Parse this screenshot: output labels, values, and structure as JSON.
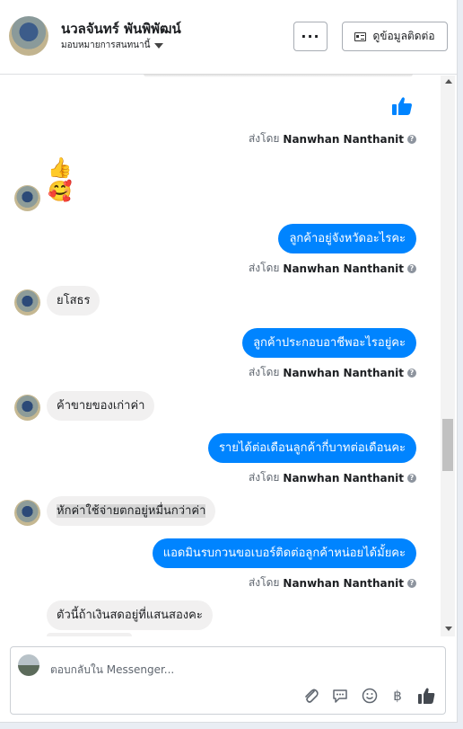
{
  "header": {
    "name": "นวลจันทร์ พันพิพัฒน์",
    "subtitle": "มอบหมายการสนทนานี้",
    "more_label": "···",
    "contact_label": "ดูข้อมูลติดต่อ"
  },
  "sent_prefix": "ส่งโดย",
  "sender": "Nanwhan Nanthanit",
  "info_glyph": "?",
  "messages": [
    {
      "type": "out-like"
    },
    {
      "type": "in-emoji",
      "emoji1": "👍",
      "emoji2": "🥰"
    },
    {
      "type": "out",
      "text": "ลูกค้าอยู่จังหวัดอะไรคะ"
    },
    {
      "type": "in",
      "text": "ยโสธร"
    },
    {
      "type": "out",
      "text": "ลูกค้าประกอบอาชีพอะไรอยู่คะ"
    },
    {
      "type": "in",
      "text": "ค้าขายของเก่าค่า"
    },
    {
      "type": "out",
      "text": "รายได้ต่อเดือนลูกค้ากี่บาทต่อเดือนคะ"
    },
    {
      "type": "in",
      "text": "หักค่าใช้จ่ายตกอยู่หมื่นกว่าค่า"
    },
    {
      "type": "out",
      "text": "แอดมินรบกวนขอเบอร์ติดต่อลูกค้าหน่อยได้มั้ยคะ"
    },
    {
      "type": "in",
      "text": "ตัวนี้ถ้าเงินสดอยู่ที่แสนสองคะ"
    }
  ],
  "composer": {
    "placeholder": "ตอบกลับใน Messenger...",
    "tools": [
      "attach-icon",
      "chat-icon",
      "emoji-icon",
      "baht-icon",
      "like-icon"
    ],
    "baht_glyph": "฿"
  },
  "colors": {
    "outgoing_bubble": "#0084ff",
    "incoming_bubble": "#f1f0f0"
  }
}
